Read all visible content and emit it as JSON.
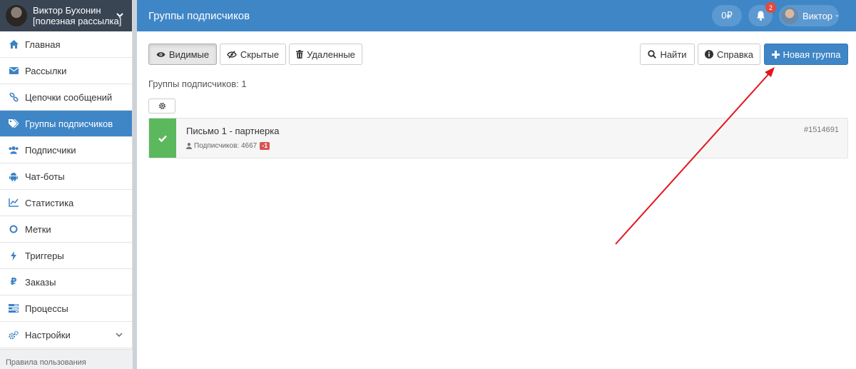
{
  "sidebar": {
    "profile": {
      "name": "Виктор Бухонин",
      "subtitle": "[полезная рассылка]"
    },
    "items": [
      {
        "label": "Главная",
        "icon": "home-icon"
      },
      {
        "label": "Рассылки",
        "icon": "envelope-icon"
      },
      {
        "label": "Цепочки сообщений",
        "icon": "link-icon"
      },
      {
        "label": "Группы подписчиков",
        "icon": "tags-icon",
        "active": true
      },
      {
        "label": "Подписчики",
        "icon": "users-icon"
      },
      {
        "label": "Чат-боты",
        "icon": "android-icon"
      },
      {
        "label": "Статистика",
        "icon": "chart-line-icon"
      },
      {
        "label": "Метки",
        "icon": "circle-icon"
      },
      {
        "label": "Триггеры",
        "icon": "bolt-icon"
      },
      {
        "label": "Заказы",
        "icon": "ruble-icon"
      },
      {
        "label": "Процессы",
        "icon": "tasks-icon"
      },
      {
        "label": "Настройки",
        "icon": "cogs-icon"
      }
    ],
    "footer_link": "Правила пользования"
  },
  "header": {
    "title": "Группы подписчиков",
    "balance": "0₽",
    "notifications_count": "2",
    "user_name": "Виктор"
  },
  "toolbar": {
    "visible_label": "Видимые",
    "hidden_label": "Скрытые",
    "deleted_label": "Удаленные",
    "search_label": "Найти",
    "help_label": "Справка",
    "new_group_label": "Новая группа"
  },
  "content": {
    "count_text": "Группы подписчиков: 1",
    "groups": [
      {
        "name": "Письмо 1 - партнерка",
        "subscribers_label": "Подписчиков: 4667",
        "delta": "-1",
        "id": "#1514691"
      }
    ]
  },
  "colors": {
    "header_blue": "#3f86c7",
    "sidebar_profile": "#3a4553",
    "success_green": "#5cb85c",
    "danger_red": "#d9534f",
    "annotation_arrow": "#e3161e"
  }
}
